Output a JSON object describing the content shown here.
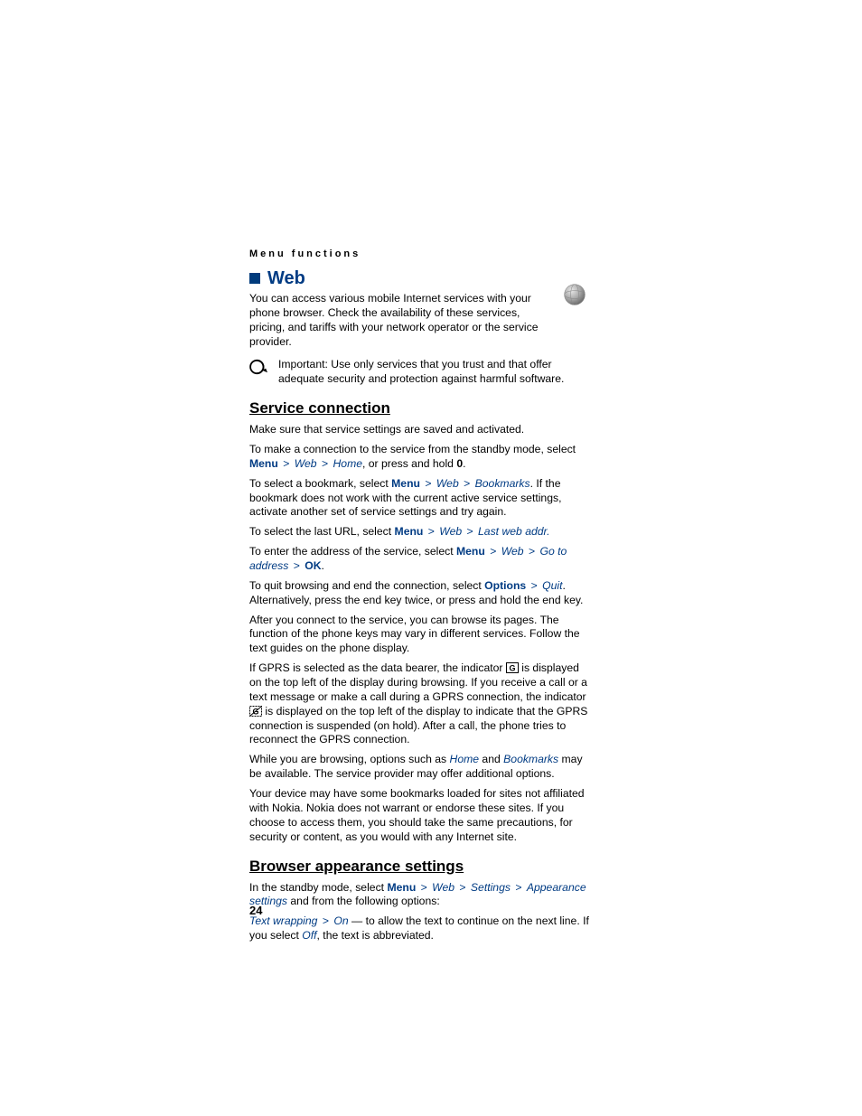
{
  "runningHead": "Menu functions",
  "headingWeb": "Web",
  "intro": "You can access various mobile Internet services with your phone browser. Check the availability of these services, pricing, and tariffs with your network operator or the service provider.",
  "importantLabel": "Important:",
  "importantText": " Use only services that you trust and that offer adequate security and protection against harmful software.",
  "h2_service": "Service connection",
  "svc1": "Make sure that service settings are saved and activated.",
  "svc2_a": "To make a connection to the service from the standby mode, select ",
  "menu": "Menu",
  "gt": ">",
  "web": "Web",
  "home": "Home",
  "svc2_b": ", or press and hold ",
  "zero": "0",
  "period": ".",
  "svc3_a": "To select a bookmark, select ",
  "bookmarks": "Bookmarks",
  "svc3_b": ". If the bookmark does not work with the current active service settings, activate another set of service settings and try again.",
  "svc4_a": "To select the last URL, select ",
  "lastweb": "Last web addr.",
  "svc5_a": "To enter the address of the service, select ",
  "gotoaddr": "Go to address",
  "ok": "OK",
  "svc6_a": "To quit browsing and end the connection, select ",
  "options": "Options",
  "quit": "Quit",
  "svc6_b": ". Alternatively, press the end key twice, or press and hold the end key.",
  "svc7": "After you connect to the service, you can browse its pages. The function of the phone keys may vary in different services. Follow the text guides on the phone display.",
  "svc8_a": "If GPRS is selected as the data bearer, the indicator ",
  "svc8_b": " is displayed on the top left of the display during browsing. If you receive a call or a text message or make a call during a GPRS connection, the indicator ",
  "svc8_c": " is displayed on the top left of the display to indicate that the GPRS connection is suspended (on hold). After a call, the phone tries to reconnect the GPRS connection.",
  "svc9_a": "While you are browsing, options such as ",
  "and": " and ",
  "svc9_b": " may be available. The service provider may offer additional options.",
  "svc10": "Your device may have some bookmarks loaded for sites not affiliated with Nokia. Nokia does not warrant or endorse these sites. If you choose to access them, you should take the same precautions, for security or content, as you would with any Internet site.",
  "h2_browser": "Browser appearance settings",
  "br1_a": "In the standby mode, select ",
  "settings": "Settings",
  "appsettings": "Appearance settings",
  "br1_b": " and from the following options:",
  "textwrap": "Text wrapping",
  "on": "On",
  "br2_a": " — to allow the text to continue on the next line. If you select ",
  "off": "Off",
  "br2_b": ", the text is abbreviated.",
  "pageNum": "24"
}
